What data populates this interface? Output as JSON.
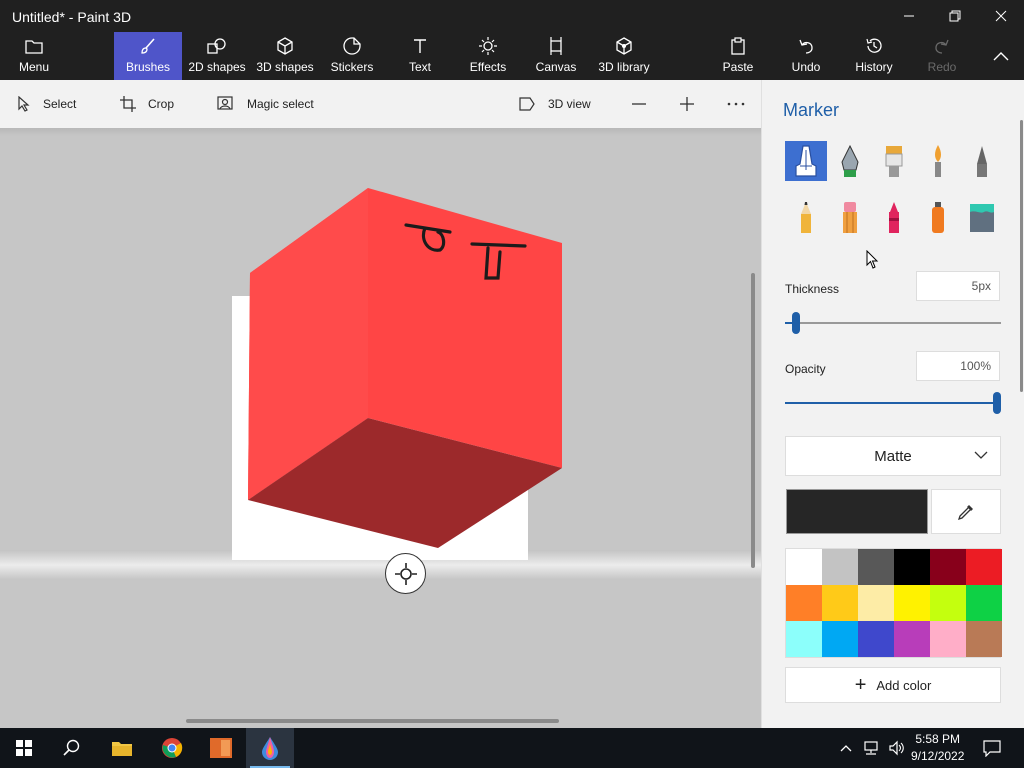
{
  "window": {
    "title": "Untitled* - Paint 3D",
    "controls": [
      "minimize-icon",
      "restore-icon",
      "close-icon"
    ]
  },
  "ribbon": {
    "menu": "Menu",
    "brushes": "Brushes",
    "shapes2d": "2D shapes",
    "shapes3d": "3D shapes",
    "stickers": "Stickers",
    "text": "Text",
    "effects": "Effects",
    "canvas": "Canvas",
    "library3d": "3D library",
    "paste": "Paste",
    "undo": "Undo",
    "history": "History",
    "redo": "Redo",
    "accent_color": "#4f55c9"
  },
  "toolbar": {
    "select": "Select",
    "crop": "Crop",
    "magic_select": "Magic select",
    "view3d": "3D view"
  },
  "canvas": {
    "object_color": "#ff4545",
    "object": "red 3D cube with black marker drawing on the front face"
  },
  "panel": {
    "title": "Marker",
    "brushes": [
      "marker",
      "calligraphy-pen",
      "oil-brush",
      "watercolor",
      "pixel-pen",
      "pencil",
      "eraser",
      "crayon",
      "spray-can",
      "fill"
    ],
    "selected_brush": "marker",
    "thickness_label": "Thickness",
    "thickness_value": "5px",
    "thickness_fraction": 0.05,
    "opacity_label": "Opacity",
    "opacity_value": "100%",
    "opacity_fraction": 1.0,
    "finish": "Matte",
    "current_color": "#262626",
    "palette": [
      "#ffffff",
      "#c3c3c3",
      "#585858",
      "#000000",
      "#88001b",
      "#ec1c24",
      "#ff7f27",
      "#ffca18",
      "#fdeca6",
      "#fff200",
      "#c4ff0e",
      "#0ed145",
      "#8cfffb",
      "#00a8f3",
      "#3f48cc",
      "#b83dba",
      "#ffaec8",
      "#b97a56"
    ],
    "add_color": "Add color"
  },
  "taskbar": {
    "time": "5:58 PM",
    "date": "9/12/2022"
  }
}
